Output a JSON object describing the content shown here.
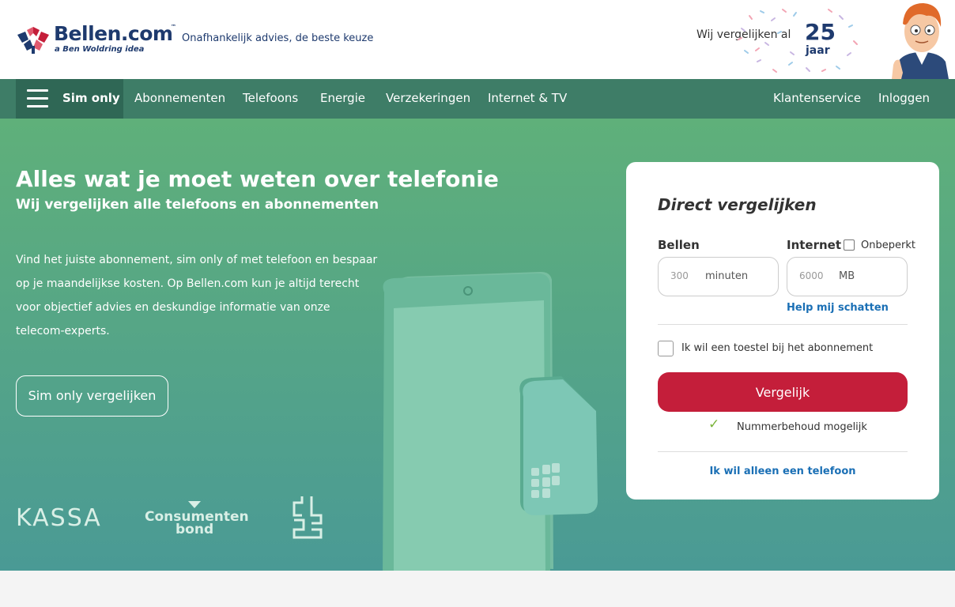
{
  "header": {
    "logo_text": "Bellen.com",
    "logo_tm": "™",
    "logo_sub": "a Ben Woldring idea",
    "tagline": "Onafhankelijk advies, de beste keuze",
    "anniversary_text": "Wij vergelijken al",
    "anniversary_number": "25",
    "anniversary_unit": "jaar"
  },
  "nav": {
    "active": "Sim only",
    "items": [
      "Abonnementen",
      "Telefoons",
      "Energie",
      "Verzekeringen",
      "Internet & TV"
    ],
    "right": [
      "Klantenservice",
      "Inloggen"
    ]
  },
  "hero": {
    "title": "Alles wat je moet weten over telefonie",
    "subtitle": "Wij vergelijken alle telefoons en abonnementen",
    "body": "Vind het juiste abonnement, sim only of met telefoon en bespaar op je maandelijkse kosten. Op Bellen.com kun je altijd terecht voor objectief advies en deskundige informatie van onze telecom-experts.",
    "cta": "Sim only vergelijken",
    "logos": {
      "kassa": "KASSA",
      "consumentenbond_line1": "Consumenten",
      "consumentenbond_line2": "bond"
    }
  },
  "compare": {
    "title": "Direct vergelijken",
    "calls_label": "Bellen",
    "calls_placeholder": "300",
    "calls_unit": "minuten",
    "internet_label": "Internet",
    "unlimited_label": "Onbeperkt",
    "internet_placeholder": "6000",
    "internet_unit": "MB",
    "help_link": "Help mij schatten",
    "device_label": "Ik wil een toestel bij het abonnement",
    "submit": "Vergelijk",
    "number_keep": "Nummerbehoud mogelijk",
    "phone_only_link": "Ik wil alleen een telefoon"
  },
  "colors": {
    "nav": "#3e7d67",
    "nav_active": "#2f6755",
    "brand_navy": "#1e3a6e",
    "cta_red": "#c41e3a",
    "link_blue": "#1a6fb5"
  }
}
